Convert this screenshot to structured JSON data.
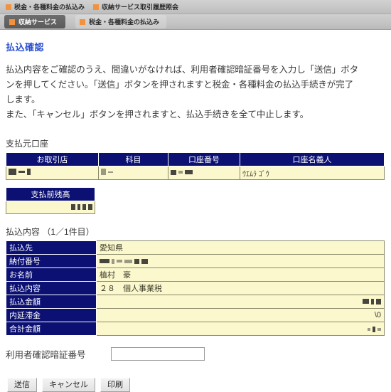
{
  "navbar": {
    "top_links": [
      {
        "label": "税金・各種料金の払込み",
        "icon": "orange-square-icon"
      },
      {
        "label": "収納サービス取引履歴照会",
        "icon": "orange-square-icon"
      }
    ],
    "tabs": [
      {
        "label": "収納サービス",
        "state": "active",
        "icon": "orange-square-icon"
      },
      {
        "label": "税金・各種料金の払込み",
        "state": "inactive",
        "icon": "orange-square-icon"
      }
    ]
  },
  "page": {
    "title": "払込確認",
    "intro": [
      "払込内容をご確認のうえ、間違いがなければ、利用者確認暗証番号を入力し「送信」ボタ",
      "ンを押してください。「送信」ボタンを押されますと税金・各種料金の払込手続きが完了",
      "します。",
      "また、「キャンセル」ボタンを押されますと、払込手続きを全て中止します。"
    ]
  },
  "source_account": {
    "section_label": "支払元口座",
    "headers": [
      "お取引店",
      "科目",
      "口座番号",
      "口座名義人"
    ],
    "row": {
      "branch": "",
      "account_type": "",
      "account_number": "",
      "account_holder": "ｳｴﾑﾗ ｺﾞｳ"
    }
  },
  "balance": {
    "header": "支払前残高",
    "value": ""
  },
  "payment": {
    "section_label": "払込内容 （1／1件目）",
    "rows": [
      {
        "label": "払込先",
        "value": "愛知県",
        "align": "left",
        "redacted": false
      },
      {
        "label": "納付番号",
        "value": "",
        "align": "left",
        "redacted": true
      },
      {
        "label": "お名前",
        "value": "植村　豪",
        "align": "left",
        "redacted": false
      },
      {
        "label": "払込内容",
        "value": "２８　個人事業税",
        "align": "left",
        "redacted": false
      },
      {
        "label": "払込金額",
        "value": "",
        "align": "right",
        "redacted": true
      },
      {
        "label": "内延滞金",
        "value": "\\0",
        "align": "right",
        "redacted": false
      },
      {
        "label": "合計金額",
        "value": "",
        "align": "right",
        "redacted": true
      }
    ]
  },
  "pin": {
    "label": "利用者確認暗証番号",
    "value": "",
    "placeholder": ""
  },
  "buttons": [
    {
      "label": "送信",
      "name": "submit-button"
    },
    {
      "label": "キャンセル",
      "name": "cancel-button"
    },
    {
      "label": "印刷",
      "name": "print-button"
    }
  ],
  "colors": {
    "header_blue": "#0b1072",
    "cell_yellow": "#fbf8cd",
    "accent_orange": "#f2923c",
    "title_blue": "#2a4fd0"
  }
}
